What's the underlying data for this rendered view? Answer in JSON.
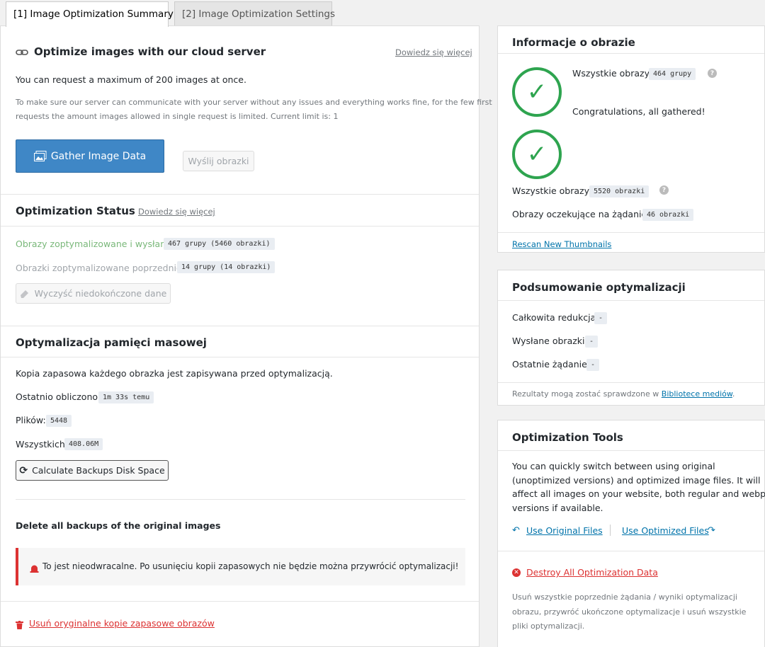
{
  "tabs": [
    {
      "label": "[1] Image Optimization Summary"
    },
    {
      "label": "[2] Image Optimization Settings"
    }
  ],
  "cloud": {
    "title": "Optimize images with our cloud server",
    "learn_more": "Dowiedz się więcej",
    "max_text": "You can request a maximum of 200 images at once.",
    "note_line1": "To make sure our server can communicate with your server without any issues and everything works fine, for the few first",
    "note_line2": "requests the amount images allowed in single request is limited. Current limit is: 1",
    "gather_button": "Gather Image Data",
    "send_button": "Wyślij obrazki"
  },
  "status": {
    "title": "Optimization Status",
    "learn_more": "Dowiedz się więcej",
    "optimized_label": "Obrazy zoptymalizowane i wysłane:",
    "optimized_value": "467 grupy (5460 obrazki)",
    "previous_label": "Obrazki zoptymalizowane poprzednio:",
    "previous_value": "14 grupy (14 obrazki)",
    "clear_button": "Wyczyść niedokończone dane"
  },
  "storage": {
    "title": "Optymalizacja pamięci masowej",
    "backup_text": "Kopia zapasowa każdego obrazka jest zapisywana przed optymalizacją.",
    "last_calc_label": "Ostatnio obliczono:",
    "last_calc_value": "1m 33s temu",
    "files_label": "Plików:",
    "files_value": "5448",
    "total_label": "Wszystkich:",
    "total_value": "408.06M",
    "calc_button": "Calculate Backups Disk Space",
    "delete_title": "Delete all backups of the original images",
    "warning": "To jest nieodwracalne. Po usunięciu kopii zapasowych nie będzie można przywrócić optymalizacji!",
    "delete_link": "Usuń oryginalne kopie zapasowe obrazów"
  },
  "info": {
    "title": "Informacje o obrazie",
    "all_images_label": "Wszystkie obrazy:",
    "all_groups_value": "464 grupy",
    "congrats": "Congratulations, all gathered!",
    "all_images_value": "5520 obrazki",
    "pending_label": "Obrazy oczekujące na żądanie:",
    "pending_value": "46 obrazki",
    "rescan_link": "Rescan New Thumbnails",
    "help_glyph": "?"
  },
  "summary": {
    "title": "Podsumowanie optymalizacji",
    "reduction_label": "Całkowita redukcja:",
    "reduction_value": "-",
    "sent_label": "Wysłane obrazki:",
    "sent_value": "-",
    "last_label": "Ostatnie żądanie:",
    "last_value": "-",
    "footer_text": "Rezultaty mogą zostać sprawdzone w ",
    "footer_link": "Bibliotece mediów",
    "footer_end": "."
  },
  "tools": {
    "title": "Optimization Tools",
    "desc_line1": "You can quickly switch between using original",
    "desc_line2": "(unoptimized versions) and optimized image files. It will",
    "desc_line3": "affect all images on your website, both regular and webp",
    "desc_line4": "versions if available.",
    "use_original": "Use Original Files",
    "use_optimized": "Use Optimized Files",
    "destroy": "Destroy All Optimization Data",
    "destroy_line1": "Usuń wszystkie poprzednie żądania / wyniki optymalizacji",
    "destroy_line2": "obrazu, przywróć ukończone optymalizacje i usuń wszystkie",
    "destroy_line3": "pliki optymalizacji."
  },
  "colors": {
    "accent": "#3f87c6",
    "success": "#2ea44f",
    "danger": "#dc3232",
    "optimized_text": "#7ab87a"
  }
}
